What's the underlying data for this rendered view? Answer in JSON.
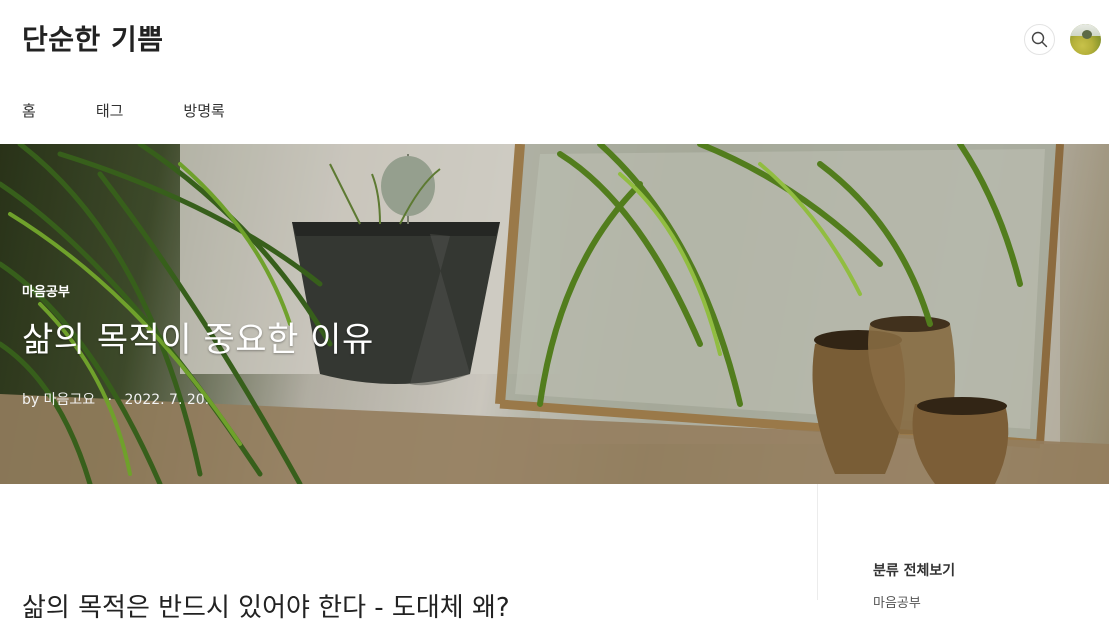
{
  "header": {
    "site_title": "단순한 기쁨"
  },
  "nav": {
    "items": [
      "홈",
      "태그",
      "방명록"
    ]
  },
  "hero": {
    "category": "마음공부",
    "title": "삶의 목적이 중요한 이유",
    "author_prefix": "by",
    "author": "마음고요",
    "separator": "·",
    "date": "2022. 7. 20."
  },
  "content": {
    "heading": "삶의 목적은 반드시 있어야 한다 - 도대체 왜?"
  },
  "sidebar": {
    "title": "분류 전체보기",
    "first_item": "마음공부"
  },
  "icons": {
    "search": "search-icon",
    "avatar": "profile-avatar"
  }
}
